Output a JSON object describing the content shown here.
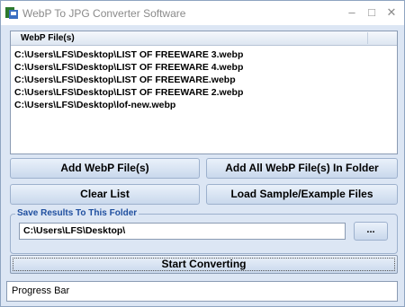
{
  "window": {
    "title": "WebP To JPG Converter Software",
    "icon": "app-icon",
    "controls": {
      "minimize": "–",
      "maximize": "□",
      "close": "✕"
    }
  },
  "file_list": {
    "column_header": "WebP File(s)",
    "rows": [
      "C:\\Users\\LFS\\Desktop\\LIST OF FREEWARE 3.webp",
      "C:\\Users\\LFS\\Desktop\\LIST OF FREEWARE 4.webp",
      "C:\\Users\\LFS\\Desktop\\LIST OF FREEWARE.webp",
      "C:\\Users\\LFS\\Desktop\\LIST OF FREEWARE 2.webp",
      "C:\\Users\\LFS\\Desktop\\lof-new.webp"
    ]
  },
  "buttons": {
    "add_files": "Add WebP File(s)",
    "add_all": "Add All WebP File(s) In Folder",
    "clear_list": "Clear List",
    "load_sample": "Load Sample/Example Files",
    "browse": "...",
    "start": "Start Converting"
  },
  "output": {
    "group_label": "Save Results To This Folder",
    "folder_value": "C:\\Users\\LFS\\Desktop\\"
  },
  "progress": {
    "label": "Progress Bar"
  }
}
